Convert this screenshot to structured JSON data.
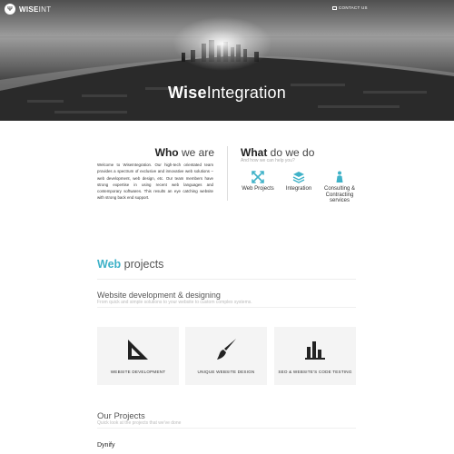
{
  "header": {
    "logo_mark": "Ψ",
    "logo_bold": "WISE",
    "logo_light": "INT",
    "contact_label": "CONTACT US"
  },
  "hero": {
    "title_bold": "Wise",
    "title_light": "Integration"
  },
  "who": {
    "title_bold": "Who",
    "title_light": " we are",
    "text": "Welcome to WiseIntegration. Our high-tech orientated team provides a spectrum of exclusive and innovative web solutions – web development, web design, etc. Our team members have strong expertise in using recent web languages and contemporary softwares. This results an eye catching website with strong back end support."
  },
  "what": {
    "title_bold": "What",
    "title_light": " do we do",
    "subtitle": "And how we can help you?",
    "services": [
      {
        "label": "Web Projects",
        "icon": "cross-arrows-icon"
      },
      {
        "label": "Integration",
        "icon": "layers-icon"
      },
      {
        "label": "Consulting & Contracting services",
        "icon": "person-icon"
      }
    ]
  },
  "web_projects": {
    "title_bold": "Web",
    "title_light": " projects",
    "section_title": "Website development & designing",
    "section_sub": "From quick and simple solutions to your website to custom complex systems.",
    "cards": [
      {
        "label": "WEBSITE DEVELOPMENT",
        "icon": "set-square-icon"
      },
      {
        "label": "UNIQUE WEBSITE DESIGN",
        "icon": "paintbrush-icon"
      },
      {
        "label": "SEO & WEBSITE'S CODE TESTING",
        "icon": "bar-chart-icon"
      }
    ]
  },
  "our_projects": {
    "title": "Our Projects",
    "subtitle": "Quick look at the projects that we've done",
    "first_project": "Dynify"
  },
  "colors": {
    "accent": "#3fb2c8"
  }
}
